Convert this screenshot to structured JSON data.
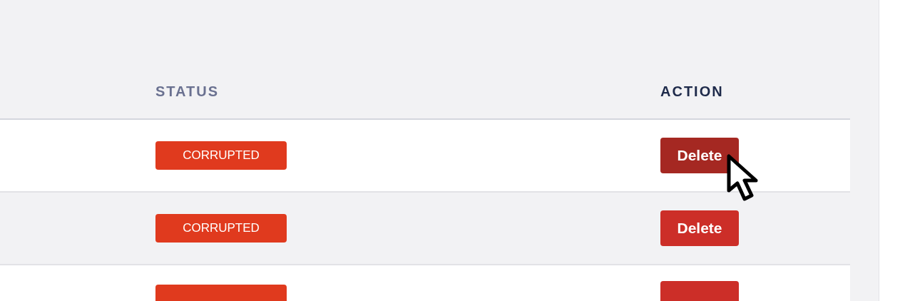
{
  "table": {
    "columns": [
      "STATUS",
      "ACTION"
    ],
    "rows": [
      {
        "status": "CORRUPTED",
        "action": "Delete",
        "hovered": true
      },
      {
        "status": "CORRUPTED",
        "action": "Delete",
        "hovered": false
      },
      {
        "hovered": false
      }
    ]
  }
}
